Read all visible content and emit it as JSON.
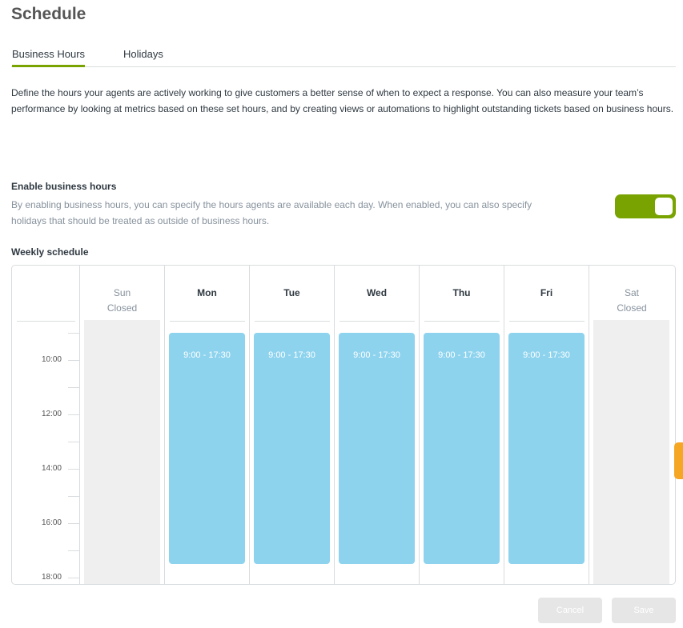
{
  "page": {
    "title": "Schedule"
  },
  "tabs": [
    {
      "label": "Business Hours",
      "active": true
    },
    {
      "label": "Holidays",
      "active": false
    }
  ],
  "intro": "Define the hours your agents are actively working to give customers a better sense of when to expect a response. You can also measure your team’s performance by looking at metrics based on these set hours, and by creating views or automations to highlight outstanding tickets based on business hours.",
  "business_hours": {
    "label": "Enable business hours",
    "description": "By enabling business hours, you can specify the hours agents are available each day. When enabled, you can also specify holidays that should be treated as outside of business hours.",
    "enabled": true
  },
  "weekly": {
    "label": "Weekly schedule",
    "hour_labels": [
      "10:00",
      "12:00",
      "14:00",
      "16:00",
      "18:00"
    ],
    "days": [
      {
        "name": "Sun",
        "status": "Closed",
        "hours": ""
      },
      {
        "name": "Mon",
        "status": "",
        "hours": "9:00 - 17:30"
      },
      {
        "name": "Tue",
        "status": "",
        "hours": "9:00 - 17:30"
      },
      {
        "name": "Wed",
        "status": "",
        "hours": "9:00 - 17:30"
      },
      {
        "name": "Thu",
        "status": "",
        "hours": "9:00 - 17:30"
      },
      {
        "name": "Fri",
        "status": "",
        "hours": "9:00 - 17:30"
      },
      {
        "name": "Sat",
        "status": "Closed",
        "hours": ""
      }
    ]
  },
  "buttons": {
    "cancel": "Cancel",
    "save": "Save"
  },
  "colors": {
    "accent": "#78a300",
    "hours_block": "#8dd3ee",
    "side_tab": "#f5a623"
  }
}
